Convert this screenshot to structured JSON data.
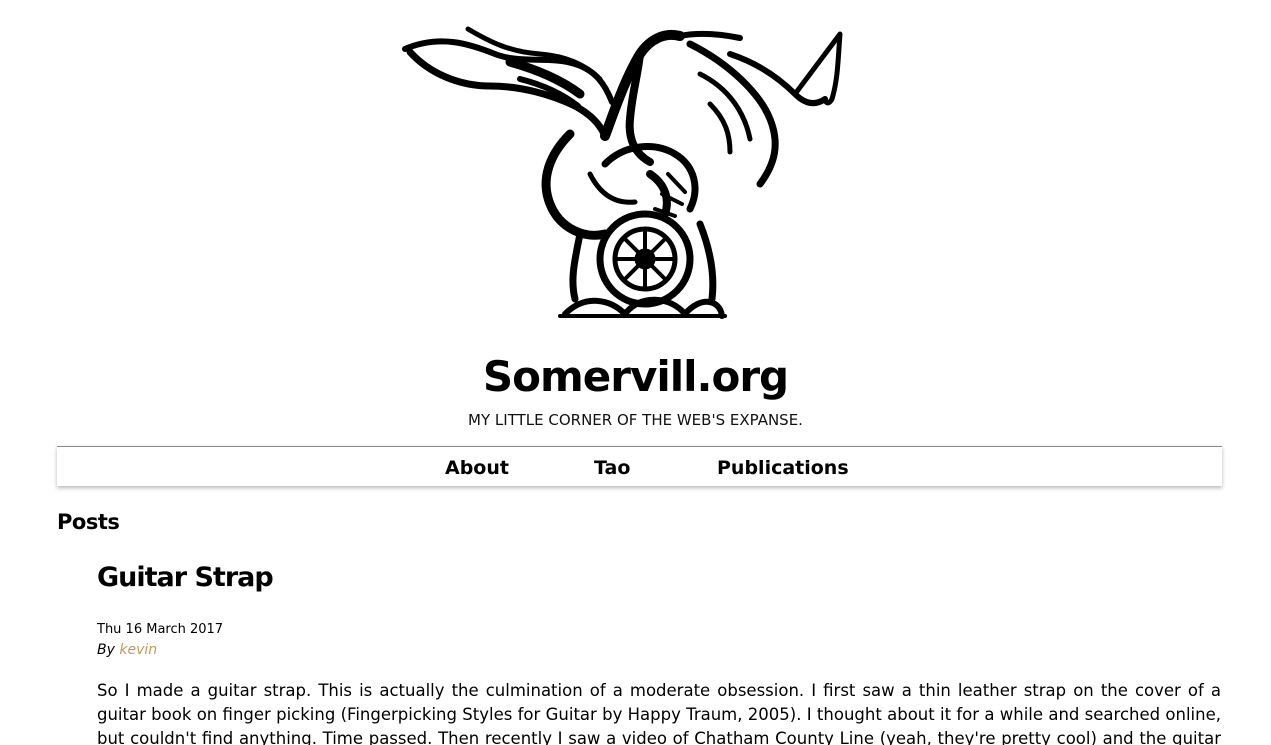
{
  "site": {
    "title": "Somervill.org",
    "tagline": "MY LITTLE CORNER OF THE WEB'S EXPANSE.",
    "logo_icon": "griffin-wheel-logo"
  },
  "nav": {
    "items": [
      {
        "label": "About"
      },
      {
        "label": "Tao"
      },
      {
        "label": "Publications"
      }
    ]
  },
  "main": {
    "section_heading": "Posts",
    "post": {
      "title": "Guitar Strap",
      "date": "Thu 16 March 2017",
      "by_label": "By",
      "author": "kevin",
      "author_color": "#c49a5c",
      "excerpt": "So I made a guitar strap. This is actually the culmination of a moderate obsession. I first saw a thin leather strap on the cover of a guitar book on finger picking (Fingerpicking Styles for Guitar by Happy Traum, 2005). I thought about it for a while and searched online, but couldn't find anything. Time passed. Then recently I saw a video of Chatham County Line (yeah, they're pretty cool) and the guitar player had a cool, thin"
    }
  }
}
